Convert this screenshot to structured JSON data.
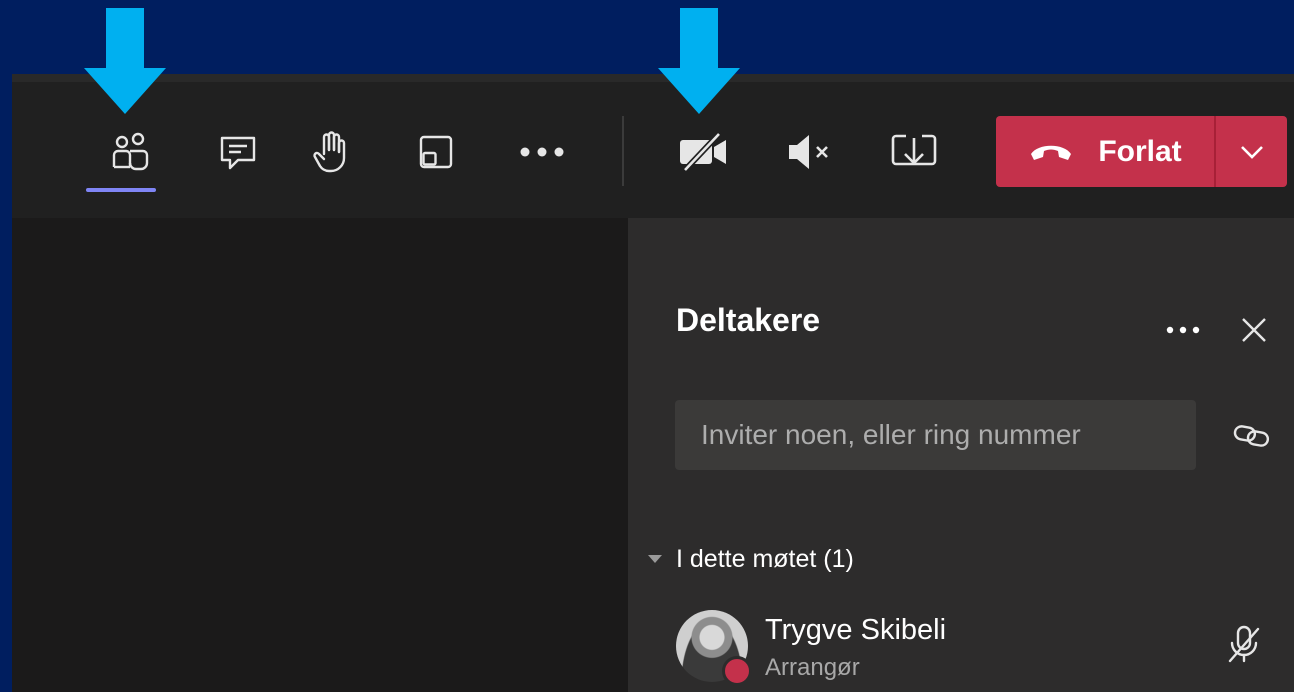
{
  "toolbar": {
    "buttons": [
      {
        "name": "participants",
        "icon": "people-icon",
        "active": true
      },
      {
        "name": "chat",
        "icon": "chat-icon"
      },
      {
        "name": "raise-hand",
        "icon": "hand-icon"
      },
      {
        "name": "rooms",
        "icon": "rooms-icon"
      },
      {
        "name": "more",
        "icon": "more-icon"
      },
      {
        "name": "camera",
        "icon": "camera-off-icon"
      },
      {
        "name": "mic",
        "icon": "speaker-mute-icon"
      },
      {
        "name": "share",
        "icon": "share-tray-icon"
      }
    ],
    "leave_label": "Forlat"
  },
  "panel": {
    "title": "Deltakere",
    "invite_placeholder": "Inviter noen, eller ring nummer",
    "section_label": "I dette møtet (1)",
    "participants": [
      {
        "name": "Trygve Skibeli",
        "role": "Arrangør",
        "status": "busy",
        "mic": "muted"
      }
    ]
  },
  "annotations": {
    "arrow_color": "#00b0f0",
    "arrow_targets": [
      "participants",
      "camera"
    ]
  },
  "colors": {
    "accent": "#7f85f5",
    "leave": "#c4314b",
    "background": "#001e5f"
  }
}
